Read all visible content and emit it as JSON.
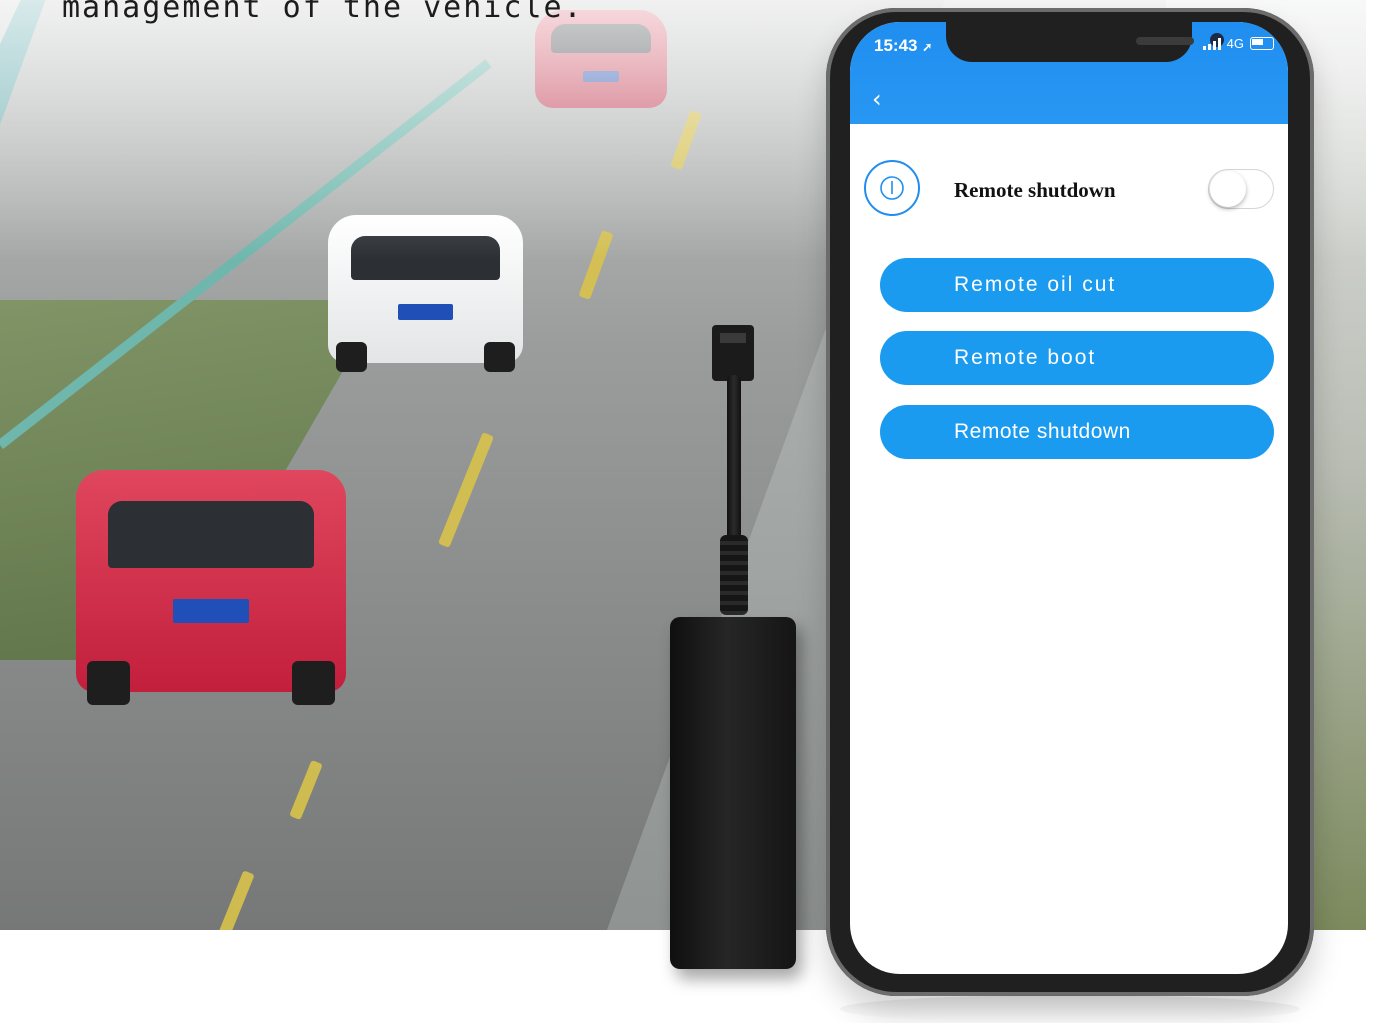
{
  "caption": "management of the vehicle.",
  "phone": {
    "status_time": "15:43",
    "status_network": "4G",
    "switch_row": {
      "label": "Remote shutdown",
      "toggle_on": false
    },
    "buttons": [
      {
        "label": "Remote oil cut"
      },
      {
        "label": "Remote boot"
      },
      {
        "label": "Remote shutdown"
      }
    ]
  },
  "colors": {
    "app_bar": "#1f8ef0",
    "button": "#1a9bef",
    "device": "#1b1b1b"
  },
  "icons": [
    "location-arrow-icon",
    "signal-icon",
    "battery-icon",
    "back-chevron-icon",
    "power-icon"
  ]
}
